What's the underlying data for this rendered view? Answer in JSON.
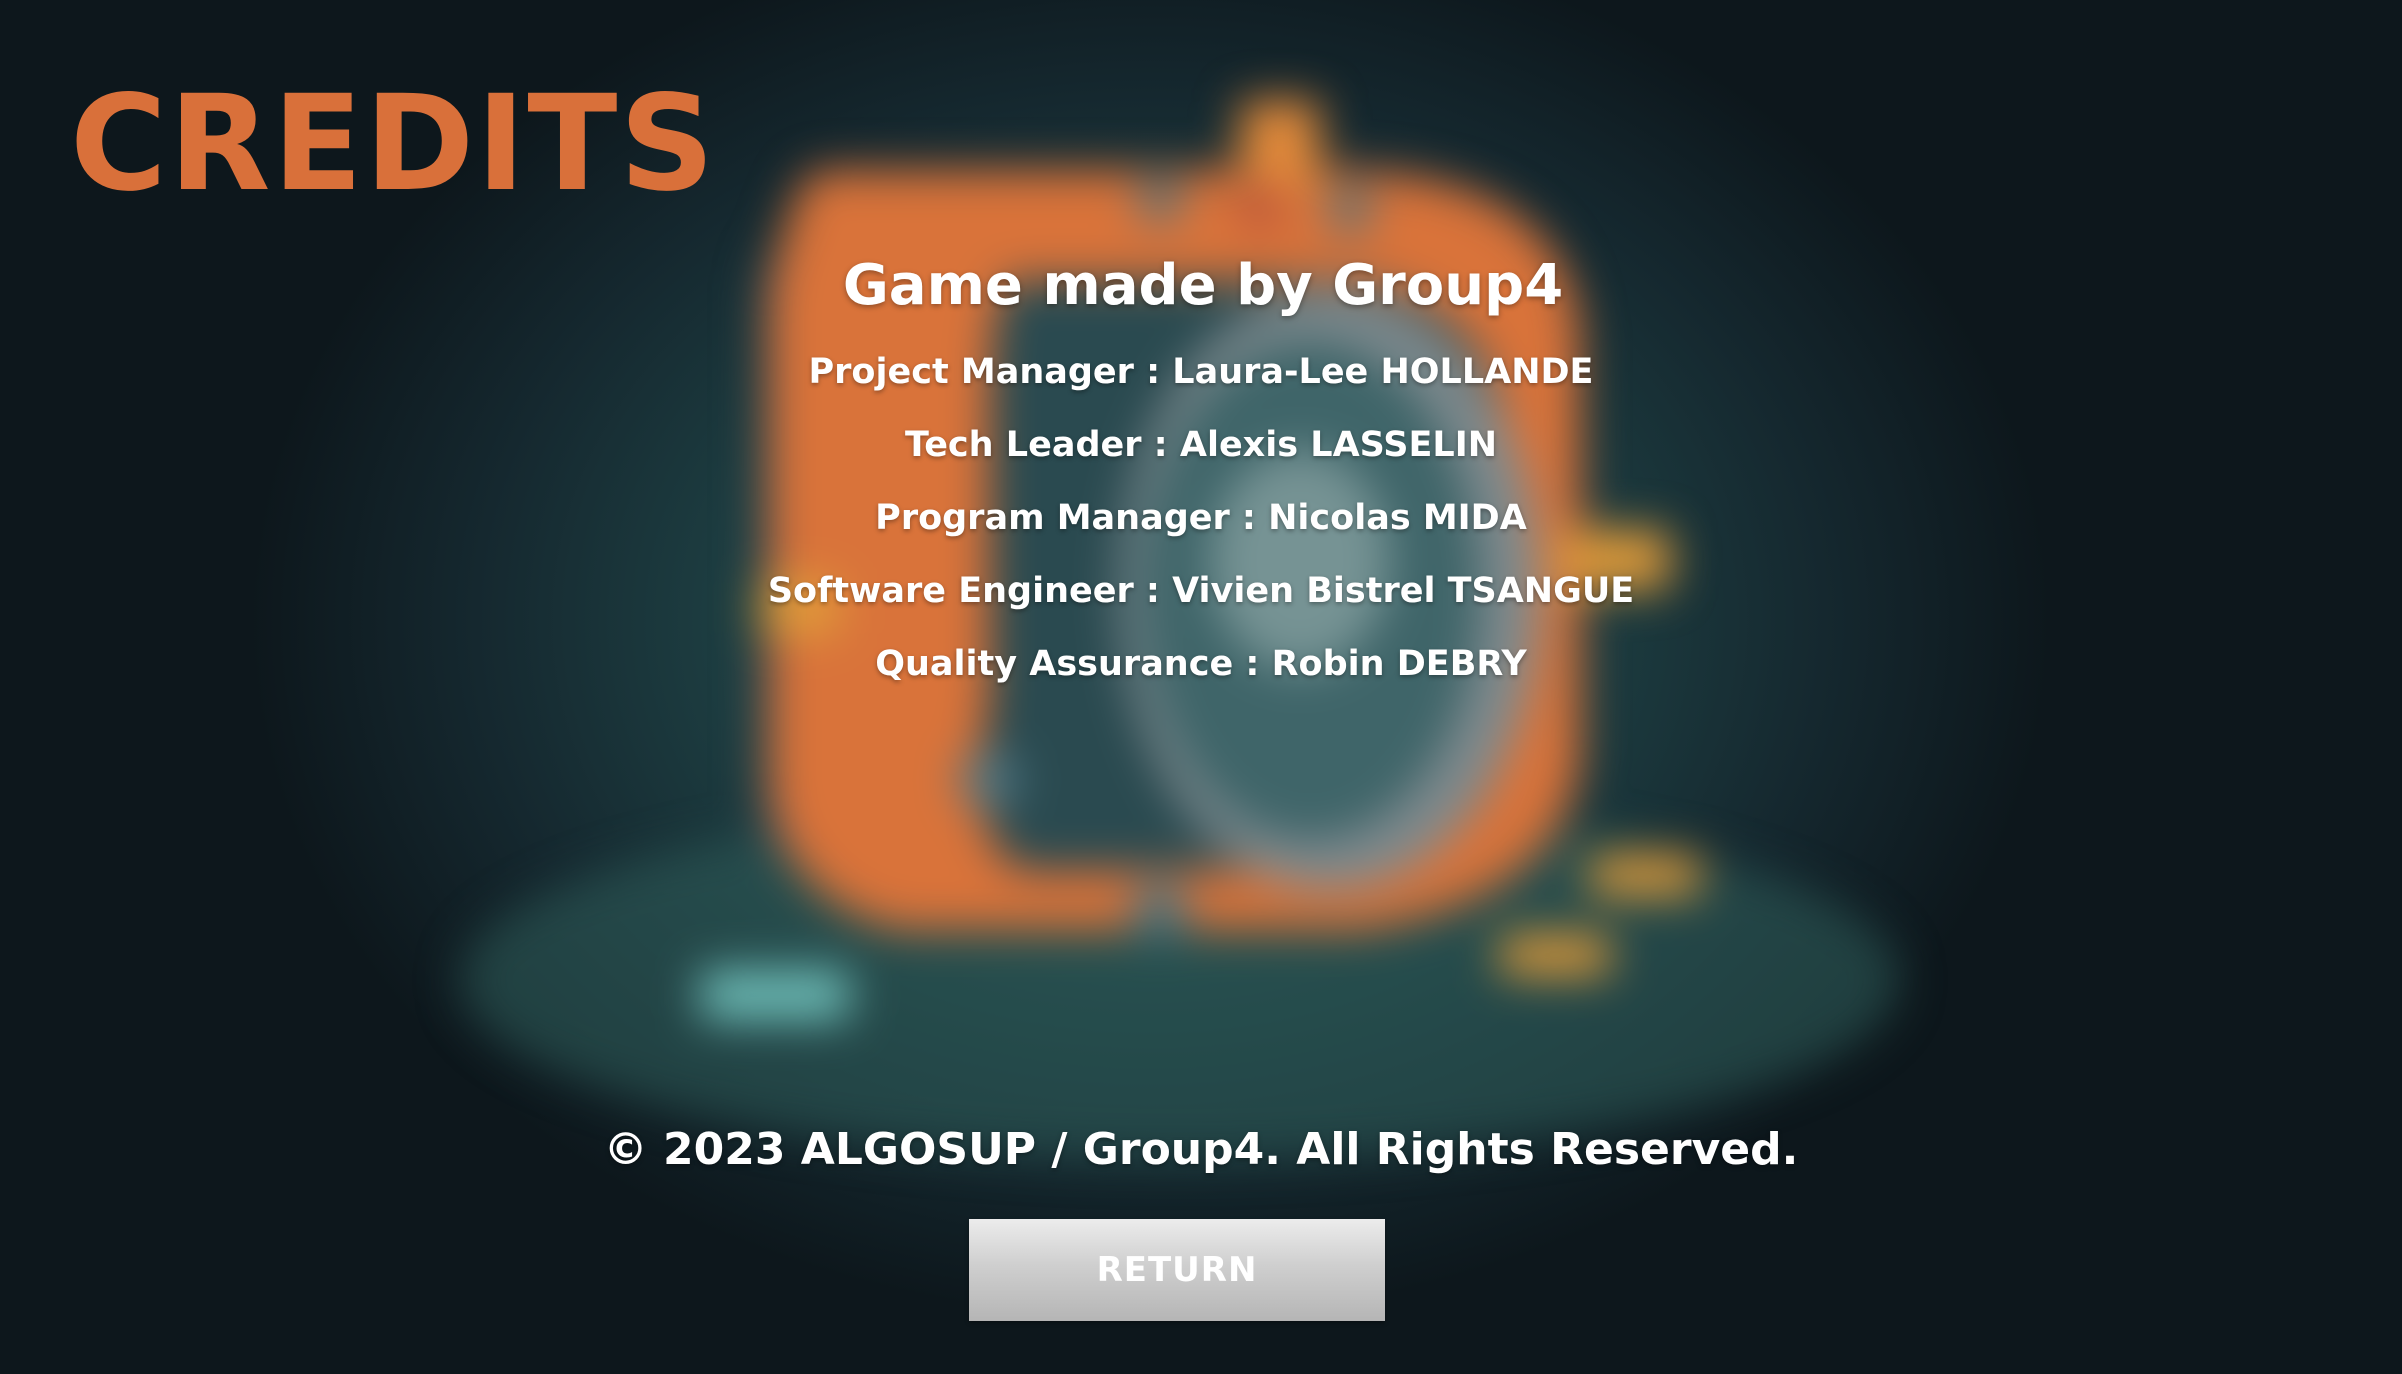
{
  "screen": {
    "title": "CREDITS"
  },
  "credits": {
    "heading": "Game made by Group4",
    "roles": [
      {
        "text": "Project Manager : Laura-Lee HOLLANDE"
      },
      {
        "text": "Tech Leader : Alexis LASSELIN"
      },
      {
        "text": "Program Manager : Nicolas MIDA"
      },
      {
        "text": "Software Engineer :  Vivien Bistrel TSANGUE"
      },
      {
        "text": "Quality Assurance : Robin DEBRY"
      }
    ]
  },
  "footer": {
    "copyright": "© 2023 ALGOSUP / Group4. All Rights Reserved.",
    "return_label": "RETURN"
  },
  "colors": {
    "title": "#d9703a",
    "text": "#ffffff",
    "background": "#1f4346",
    "button": "#c8c8c8"
  }
}
